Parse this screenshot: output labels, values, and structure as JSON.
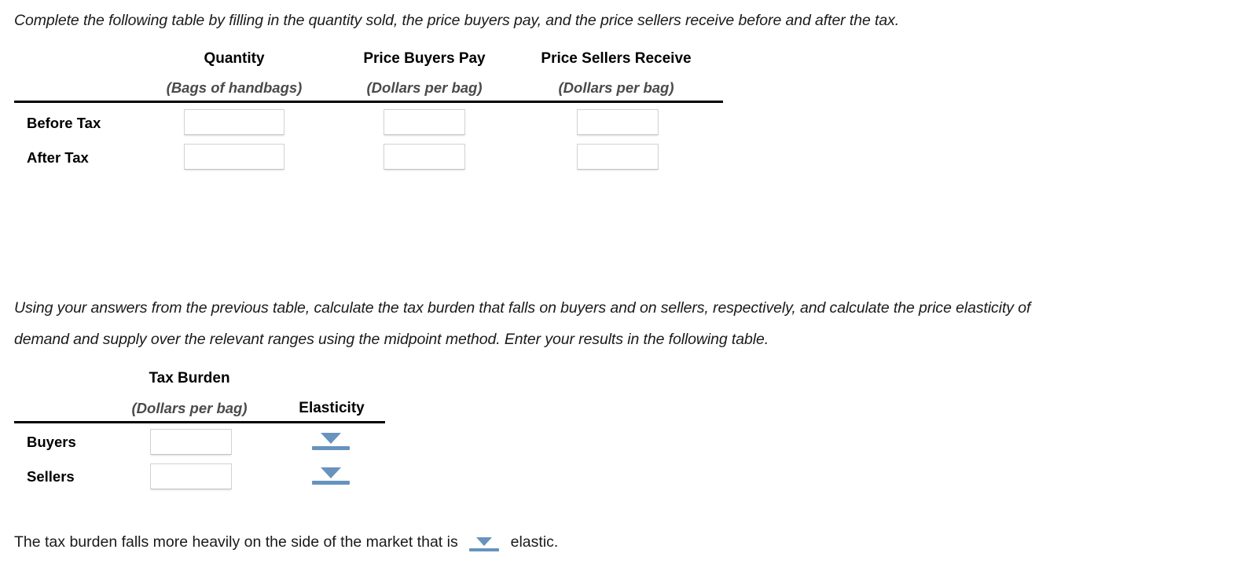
{
  "instructions": {
    "table1_prompt": "Complete the following table by filling in the quantity sold, the price buyers pay, and the price sellers receive before and after the tax.",
    "table2_prompt_line1": "Using your answers from the previous table, calculate the tax burden that falls on buyers and on sellers, respectively, and calculate the price elasticity of",
    "table2_prompt_line2": "demand and supply over the relevant ranges using the midpoint method. Enter your results in the following table."
  },
  "table1": {
    "headers": [
      {
        "title": "Quantity",
        "units": "(Bags of handbags)"
      },
      {
        "title": "Price Buyers Pay",
        "units": "(Dollars per bag)"
      },
      {
        "title": "Price Sellers Receive",
        "units": "(Dollars per bag)"
      }
    ],
    "rows": [
      {
        "label": "Before Tax",
        "cells": [
          {
            "name": "quantity-before-tax",
            "value": "",
            "placeholder": ""
          },
          {
            "name": "price-buyers-pay-before-tax",
            "value": "",
            "placeholder": ""
          },
          {
            "name": "price-sellers-receive-before-tax",
            "value": "",
            "placeholder": ""
          }
        ]
      },
      {
        "label": "After Tax",
        "cells": [
          {
            "name": "quantity-after-tax",
            "value": "",
            "placeholder": ""
          },
          {
            "name": "price-buyers-pay-after-tax",
            "value": "",
            "placeholder": ""
          },
          {
            "name": "price-sellers-receive-after-tax",
            "value": "",
            "placeholder": ""
          }
        ]
      }
    ]
  },
  "table2": {
    "headers": {
      "tax_burden": "Tax Burden",
      "tax_burden_units": "(Dollars per bag)",
      "elasticity": "Elasticity"
    },
    "rows": [
      {
        "label": "Buyers",
        "burden": {
          "value": "",
          "placeholder": ""
        },
        "elasticity": {
          "selected": ""
        }
      },
      {
        "label": "Sellers",
        "burden": {
          "value": "",
          "placeholder": ""
        },
        "elasticity": {
          "selected": ""
        }
      }
    ]
  },
  "conclusion": {
    "text_before": "The tax burden falls more heavily on the side of the market that is",
    "dropdown_selected": "",
    "text_after": "elastic."
  },
  "colors": {
    "dropdown_blue": "#6793bd",
    "rule_black": "#000000",
    "subheader_gray": "#4a4a4a",
    "input_border": "#d2d2d2"
  }
}
